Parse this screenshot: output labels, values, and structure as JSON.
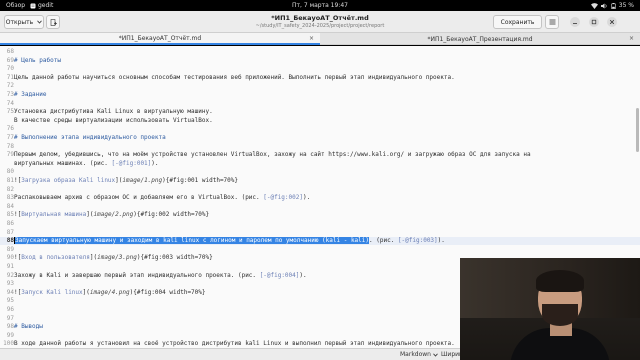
{
  "topbar": {
    "activities": "Обзор",
    "app_name": "gedit",
    "clock": "Пт, 7 марта  19:47",
    "battery": "35 %"
  },
  "header": {
    "open_label": "Открыть",
    "save_label": "Сохранить",
    "title": "*ИП1_БекауоАТ_Отчёт.md",
    "subtitle": "~/study/IT_safety_2024-2025/project/project/report"
  },
  "tabs": [
    {
      "label": "*ИП1_БекауоАТ_Отчёт.md",
      "close": "×"
    },
    {
      "label": "*ИП1_БекауоАТ_Презентация.md",
      "close": "×"
    }
  ],
  "editor": {
    "lines": [
      {
        "n": "68",
        "segs": []
      },
      {
        "n": "69",
        "segs": [
          {
            "t": "# Цель работы",
            "c": "hd"
          }
        ]
      },
      {
        "n": "70",
        "segs": []
      },
      {
        "n": "71",
        "segs": [
          {
            "t": "Цель данной работы научиться основным способам тестирования веб приложений. Выполнить первый этап индивидуального проекта.",
            "c": ""
          }
        ]
      },
      {
        "n": "72",
        "segs": []
      },
      {
        "n": "73",
        "segs": [
          {
            "t": "# Задание",
            "c": "hd"
          }
        ]
      },
      {
        "n": "74",
        "segs": []
      },
      {
        "n": "75",
        "segs": [
          {
            "t": "Установка дистрибутива Kali Linux в виртуальную машину.",
            "c": ""
          }
        ]
      },
      {
        "n": "",
        "segs": [
          {
            "t": "В качестве среды виртуализации использовать VirtualBox.",
            "c": ""
          }
        ]
      },
      {
        "n": "76",
        "segs": []
      },
      {
        "n": "77",
        "segs": [
          {
            "t": "# Выполнение этапа индивидуального проекта",
            "c": "hd"
          }
        ]
      },
      {
        "n": "78",
        "segs": []
      },
      {
        "n": "79",
        "segs": [
          {
            "t": "Первым делом, убедившись, что на моём устройстве установлен VirtualBox, захожу на сайт https://www.kali.org/  и загружаю образ ОС для запуска на",
            "c": ""
          }
        ]
      },
      {
        "n": "",
        "segs": [
          {
            "t": "   виртуальных машинах. (рис. ",
            "c": ""
          },
          {
            "t": "[-@fig:001]",
            "c": "lk"
          },
          {
            "t": ").",
            "c": ""
          }
        ]
      },
      {
        "n": "80",
        "segs": []
      },
      {
        "n": "81",
        "segs": [
          {
            "t": "![",
            "c": ""
          },
          {
            "t": "Загрузка образа Kali linux",
            "c": "lk"
          },
          {
            "t": "](",
            "c": ""
          },
          {
            "t": "image/1.png",
            "c": "it"
          },
          {
            "t": "){#fig:001 width=70%}",
            "c": ""
          }
        ]
      },
      {
        "n": "82",
        "segs": []
      },
      {
        "n": "83",
        "segs": [
          {
            "t": "Распаковываем архив с образом ОС и добавляем его в VirtualBox. (рис. ",
            "c": ""
          },
          {
            "t": "[-@fig:002]",
            "c": "lk"
          },
          {
            "t": ").",
            "c": ""
          }
        ]
      },
      {
        "n": "84",
        "segs": []
      },
      {
        "n": "85",
        "segs": [
          {
            "t": "![",
            "c": ""
          },
          {
            "t": "Виртуальная машина",
            "c": "lk"
          },
          {
            "t": "](",
            "c": ""
          },
          {
            "t": "image/2.png",
            "c": "it"
          },
          {
            "t": "){#fig:002 width=70%}",
            "c": ""
          }
        ]
      },
      {
        "n": "86",
        "segs": []
      },
      {
        "n": "87",
        "segs": []
      },
      {
        "n": "88",
        "segs": [
          {
            "t": "Запускаем виртуальную машину и заходим в kali linux с логином и паролем по умолчанию (kali - kali)",
            "c": "sel"
          },
          {
            "t": ". (рис. ",
            "c": ""
          },
          {
            "t": "[-@fig:003]",
            "c": "lk"
          },
          {
            "t": ").",
            "c": ""
          }
        ],
        "current": true
      },
      {
        "n": "89",
        "segs": []
      },
      {
        "n": "90",
        "segs": [
          {
            "t": "![",
            "c": ""
          },
          {
            "t": "Вход в пользователя",
            "c": "lk"
          },
          {
            "t": "](",
            "c": ""
          },
          {
            "t": "image/3.png",
            "c": "it"
          },
          {
            "t": "){#fig:003 width=70%}",
            "c": ""
          }
        ]
      },
      {
        "n": "91",
        "segs": []
      },
      {
        "n": "92",
        "segs": [
          {
            "t": "Захожу в Kali и завершаю первый этап индивидуального проекта. (рис. ",
            "c": ""
          },
          {
            "t": "[-@fig:004]",
            "c": "lk"
          },
          {
            "t": ").",
            "c": ""
          }
        ]
      },
      {
        "n": "93",
        "segs": []
      },
      {
        "n": "94",
        "segs": [
          {
            "t": "![",
            "c": ""
          },
          {
            "t": "Запуск Kali linux",
            "c": "lk"
          },
          {
            "t": "](",
            "c": ""
          },
          {
            "t": "image/4.png",
            "c": "it"
          },
          {
            "t": "){#fig:004 width=70%}",
            "c": ""
          }
        ]
      },
      {
        "n": "95",
        "segs": []
      },
      {
        "n": "96",
        "segs": []
      },
      {
        "n": "97",
        "segs": []
      },
      {
        "n": "98",
        "segs": [
          {
            "t": "# Выводы",
            "c": "hd"
          }
        ]
      },
      {
        "n": "99",
        "segs": []
      },
      {
        "n": "100",
        "segs": [
          {
            "t": "В ходе данной работы я установил на своё устройство дистрибутив kali Linux и выполнил первый этап индивидуального проекта.",
            "c": ""
          }
        ]
      },
      {
        "n": "101",
        "segs": []
      }
    ]
  },
  "statusbar": {
    "language": "Markdown",
    "width": "Ширин"
  },
  "colors": {
    "selection": "#3584e4",
    "heading": "#2c5aa0",
    "link": "#6b7fb5"
  }
}
